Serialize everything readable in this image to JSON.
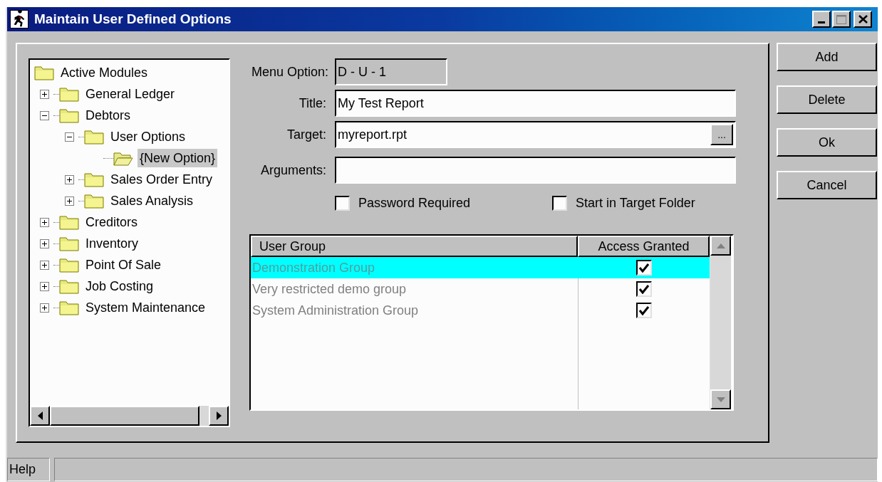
{
  "window": {
    "title": "Maintain User Defined Options"
  },
  "tree": {
    "label": "Active Modules",
    "selected": false,
    "children": [
      {
        "label": "General Ledger",
        "expanded": false,
        "selected": false
      },
      {
        "label": "Debtors",
        "expanded": true,
        "selected": false,
        "children": [
          {
            "label": "User Options",
            "expanded": true,
            "selected": false,
            "children": [
              {
                "label": "{New Option}",
                "selected": true
              }
            ]
          },
          {
            "label": "Sales Order Entry",
            "expanded": false,
            "selected": false
          },
          {
            "label": "Sales Analysis",
            "expanded": false,
            "selected": false
          }
        ]
      },
      {
        "label": "Creditors",
        "expanded": false,
        "selected": false
      },
      {
        "label": "Inventory",
        "expanded": false,
        "selected": false
      },
      {
        "label": "Point Of Sale",
        "expanded": false,
        "selected": false
      },
      {
        "label": "Job Costing",
        "expanded": false,
        "selected": false
      },
      {
        "label": "System Maintenance",
        "expanded": false,
        "selected": false
      }
    ]
  },
  "form": {
    "fields": [
      {
        "label": "Menu Option:",
        "value": "D - U - 1",
        "disabled": true
      },
      {
        "label": "Title:",
        "value": "My Test Report",
        "disabled": false
      },
      {
        "label": "Target:",
        "value": "myreport.rpt",
        "disabled": false,
        "browse": "..."
      },
      {
        "label": "Arguments:",
        "disabled": false
      }
    ],
    "checkboxes": [
      {
        "label": "Password Required",
        "checked": false
      },
      {
        "label": "Start in Target Folder",
        "checked": false
      }
    ]
  },
  "table": {
    "columns": [
      "User Group",
      "Access Granted"
    ],
    "rows": [
      {
        "group": "Demonstration Group",
        "granted": true,
        "selected": true
      },
      {
        "group": "Very restricted demo group",
        "granted": true,
        "selected": false
      },
      {
        "group": "System Administration Group",
        "granted": true,
        "selected": false
      }
    ]
  },
  "buttons": [
    "Add",
    "Delete",
    "Ok",
    "Cancel"
  ],
  "status_bar": {
    "label": "Help"
  }
}
